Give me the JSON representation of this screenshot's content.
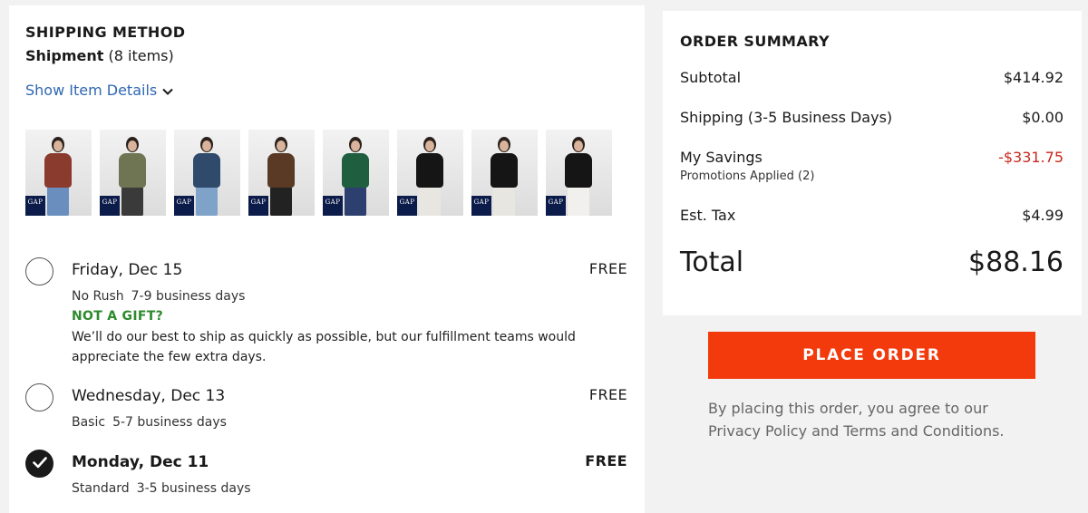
{
  "shipping": {
    "title": "SHIPPING METHOD",
    "shipment_label": "Shipment",
    "shipment_count": "(8 items)",
    "show_details": "Show Item Details",
    "thumbnails": [
      {
        "logo": "GAP",
        "top": "#8a3b2e",
        "bottom": "#6a8fbf"
      },
      {
        "logo": "GAP",
        "top": "#6f7553",
        "bottom": "#3a3a3a"
      },
      {
        "logo": "GAP",
        "top": "#2f4a6b",
        "bottom": "#7fa3c8"
      },
      {
        "logo": "GAP",
        "top": "#5a3a24",
        "bottom": "#222222"
      },
      {
        "logo": "GAP",
        "top": "#1f5e3f",
        "bottom": "#2c3f6e"
      },
      {
        "logo": "GAP",
        "top": "#151515",
        "bottom": "#e8e6e0"
      },
      {
        "logo": "GAP",
        "top": "#151515",
        "bottom": "#e8e6e0"
      },
      {
        "logo": "GAP",
        "top": "#151515",
        "bottom": "#f1f0ec"
      }
    ],
    "options": [
      {
        "date": "Friday, Dec 15",
        "price": "FREE",
        "speed": "No Rush",
        "days": "7-9 business days",
        "gift_label": "NOT A GIFT?",
        "gift_text": "We’ll do our best to ship as quickly as possible, but our fulfillment teams would appreciate the few extra days.",
        "selected": false
      },
      {
        "date": "Wednesday, Dec 13",
        "price": "FREE",
        "speed": "Basic",
        "days": "5-7 business days",
        "selected": false
      },
      {
        "date": "Monday, Dec 11",
        "price": "FREE",
        "speed": "Standard",
        "days": "3-5 business days",
        "selected": true
      }
    ]
  },
  "summary": {
    "title": "ORDER SUMMARY",
    "subtotal_label": "Subtotal",
    "subtotal_value": "$414.92",
    "shipping_label": "Shipping (3-5 Business Days)",
    "shipping_value": "$0.00",
    "savings_label": "My Savings",
    "savings_sub": "Promotions Applied (2)",
    "savings_value": "-$331.75",
    "tax_label": "Est. Tax",
    "tax_value": "$4.99",
    "total_label": "Total",
    "total_value": "$88.16"
  },
  "place_order": "PLACE ORDER",
  "legal": {
    "prefix": "By placing this order, you agree to our",
    "privacy": "Privacy Policy",
    "and": "and",
    "terms": "Terms and Conditions."
  },
  "colors": {
    "accent": "#f23a0c",
    "link": "#2f67b2",
    "savings": "#c8281e",
    "gift": "#2c8a2c"
  }
}
